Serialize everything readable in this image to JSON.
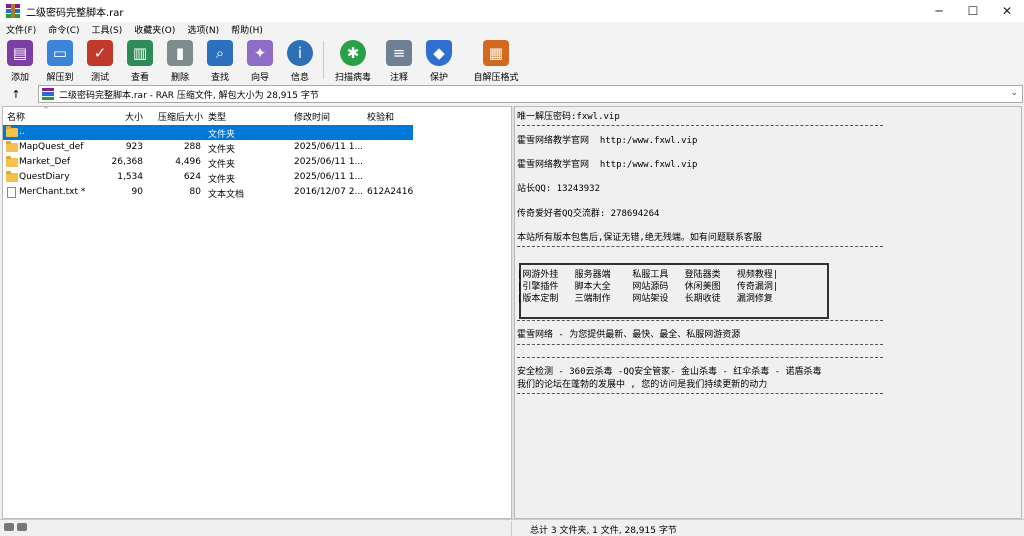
{
  "window": {
    "title": "二级密码完整脚本.rar",
    "controls": {
      "minimize": "─",
      "maximize": "☐",
      "close": "✕"
    }
  },
  "menu": [
    "文件(F)",
    "命令(C)",
    "工具(S)",
    "收藏夹(O)",
    "选项(N)",
    "帮助(H)"
  ],
  "toolbar": [
    {
      "label": "添加",
      "icon": "add-archive-icon",
      "color": "#7b3fa3"
    },
    {
      "label": "解压到",
      "icon": "extract-folder-icon",
      "color": "#3b84d8"
    },
    {
      "label": "测试",
      "icon": "test-checklist-icon",
      "color": "#c0392b"
    },
    {
      "label": "查看",
      "icon": "view-book-icon",
      "color": "#2e8b57"
    },
    {
      "label": "删除",
      "icon": "trash-bin-icon",
      "color": "#7f8c8d"
    },
    {
      "label": "查找",
      "icon": "magnifier-icon",
      "color": "#2c6fbf"
    },
    {
      "label": "向导",
      "icon": "wizard-wand-icon",
      "color": "#8e6cc8"
    },
    {
      "label": "信息",
      "icon": "info-icon",
      "color": "#2f6fb5"
    },
    {
      "label": "扫描病毒",
      "icon": "virus-scan-icon",
      "color": "#2aa146"
    },
    {
      "label": "注释",
      "icon": "comment-note-icon",
      "color": "#6f7f94"
    },
    {
      "label": "保护",
      "icon": "shield-icon",
      "color": "#2f6fd0"
    },
    {
      "label": "自解压格式",
      "icon": "sfx-archive-icon",
      "color": "#d2691e"
    }
  ],
  "address": {
    "up_icon": "↑",
    "path": "二级密码完整脚本.rar - RAR 压缩文件, 解包大小为 28,915 字节",
    "chevron": "⌄"
  },
  "columns": {
    "name": "名称",
    "size": "大小",
    "packed": "压缩后大小",
    "type": "类型",
    "modified": "修改时间",
    "crc": "校验和",
    "sort_arrow": "^"
  },
  "files": [
    {
      "name": "..",
      "size": "",
      "packed": "",
      "type": "文件夹",
      "modified": "",
      "crc": "",
      "kind": "folder",
      "selected": true
    },
    {
      "name": "MapQuest_def",
      "size": "923",
      "packed": "288",
      "type": "文件夹",
      "modified": "2025/06/11 1...",
      "crc": "",
      "kind": "folder",
      "selected": false
    },
    {
      "name": "Market_Def",
      "size": "26,368",
      "packed": "4,496",
      "type": "文件夹",
      "modified": "2025/06/11 1...",
      "crc": "",
      "kind": "folder",
      "selected": false
    },
    {
      "name": "QuestDiary",
      "size": "1,534",
      "packed": "624",
      "type": "文件夹",
      "modified": "2025/06/11 1...",
      "crc": "",
      "kind": "folder",
      "selected": false
    },
    {
      "name": "MerChant.txt *",
      "size": "90",
      "packed": "80",
      "type": "文本文档",
      "modified": "2016/12/07 2...",
      "crc": "612A2416",
      "kind": "file",
      "selected": false
    }
  ],
  "comment": {
    "line1": "唯一解压密码:fxwl.vip",
    "line2": "霍雪网络教学官网  http:/www.fxwl.vip",
    "line3": "霍雪网络教学官网  http:/www.fxwl.vip",
    "line4": "站长QQ: 13243932",
    "line5": "传奇爱好者QQ交流群: 278694264",
    "line6": "本站所有版本包售后,保证无错,绝无残端。如有问题联系客服",
    "box1": "|网游外挂   服务器端    私服工具   登陆器类   视频教程|",
    "box2": "|引擎插件   脚本大全    网站源码   休闲美图   传奇漏洞|",
    "box3": "|版本定制   三端制作    网站架设   长期收徒   漏洞修复",
    "line7": "霍雪网络 - 为您提供最新、最快、最全、私服网游资源",
    "line8": "安全检测 - 360云杀毒 -QQ安全管家- 金山杀毒 - 红伞杀毒 - 诺盾杀毒",
    "line9": "我们的论坛在蓬勃的发展中 , 您的访问是我们持续更新的动力"
  },
  "status": {
    "summary": "总计 3 文件夹, 1 文件, 28,915 字节"
  }
}
